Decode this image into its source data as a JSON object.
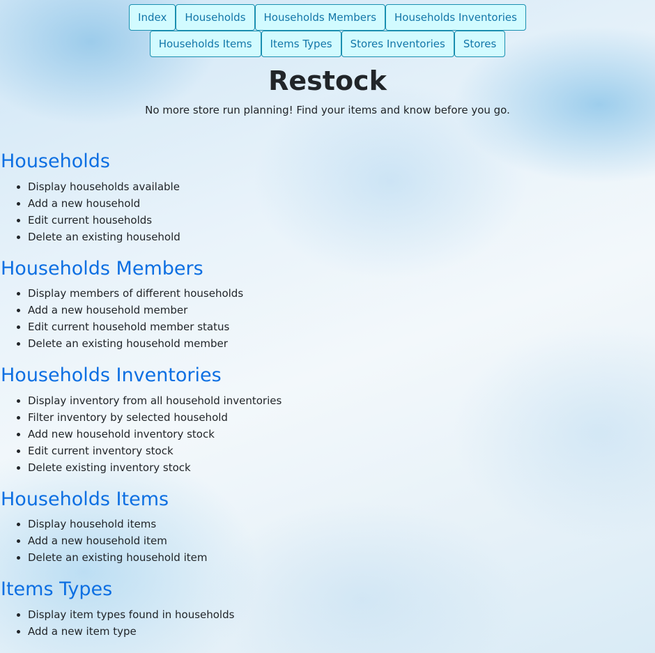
{
  "nav": {
    "row1": [
      "Index",
      "Households",
      "Households Members",
      "Households Inventories"
    ],
    "row2": [
      "Households Items",
      "Items Types",
      "Stores Inventories",
      "Stores"
    ]
  },
  "header": {
    "title": "Restock",
    "subtitle": "No more store run planning! Find your items and know before you go."
  },
  "sections": [
    {
      "heading": "Households",
      "items": [
        "Display households available",
        "Add a new household",
        "Edit current households",
        "Delete an existing household"
      ]
    },
    {
      "heading": "Households Members",
      "items": [
        "Display members of different households",
        "Add a new household member",
        "Edit current household member status",
        "Delete an existing household member"
      ]
    },
    {
      "heading": "Households Inventories",
      "items": [
        "Display inventory from all household inventories",
        "Filter inventory by selected household",
        "Add new household inventory stock",
        "Edit current inventory stock",
        "Delete existing inventory stock"
      ]
    },
    {
      "heading": "Households Items",
      "items": [
        "Display household items",
        "Add a new household item",
        "Delete an existing household item"
      ]
    },
    {
      "heading": "Items Types",
      "items": [
        "Display item types found in households",
        "Add a new item type"
      ]
    }
  ]
}
